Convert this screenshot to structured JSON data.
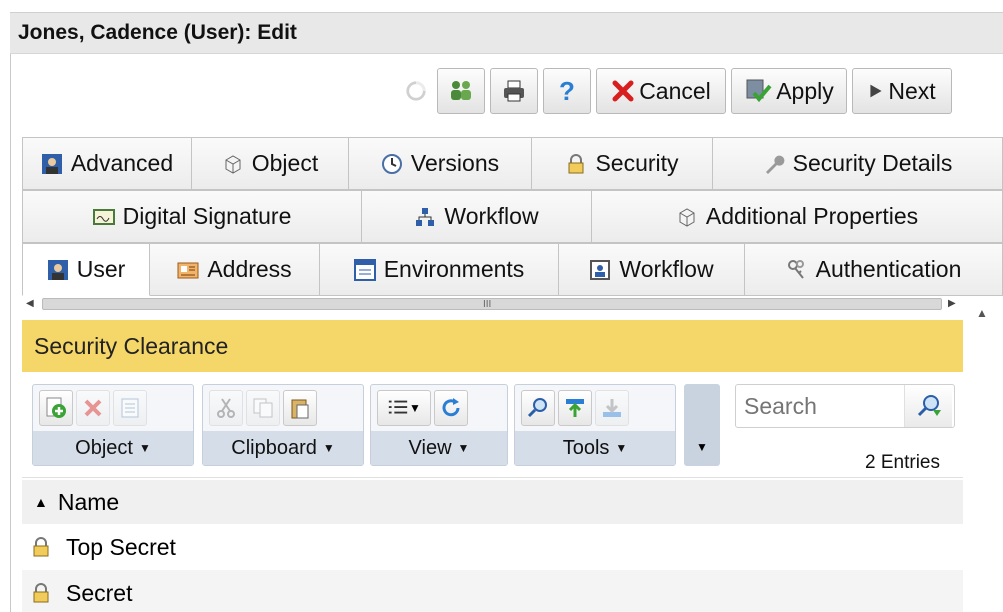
{
  "window": {
    "title": "Jones, Cadence (User): Edit"
  },
  "toolbar": {
    "cancel_label": "Cancel",
    "apply_label": "Apply",
    "next_label": "Next",
    "help_label": "?"
  },
  "tabs": {
    "row1": [
      "Advanced",
      "Object",
      "Versions",
      "Security",
      "Security Details"
    ],
    "row2": [
      "Digital Signature",
      "Workflow",
      "Additional Properties"
    ],
    "row3": [
      "User",
      "Address",
      "Environments",
      "Workflow",
      "Authentication"
    ]
  },
  "section": {
    "title": "Security Clearance"
  },
  "ribbon": {
    "object_label": "Object",
    "clipboard_label": "Clipboard",
    "view_label": "View",
    "tools_label": "Tools",
    "search_placeholder": "Search",
    "entries_text": "2 Entries"
  },
  "list": {
    "column_name": "Name",
    "rows": [
      {
        "name": "Top Secret"
      },
      {
        "name": "Secret"
      }
    ]
  },
  "colors": {
    "section_header": "#f5d669",
    "cancel_icon": "#d81e1e",
    "apply_check": "#3aa335",
    "help_blue": "#2a7fd4"
  }
}
